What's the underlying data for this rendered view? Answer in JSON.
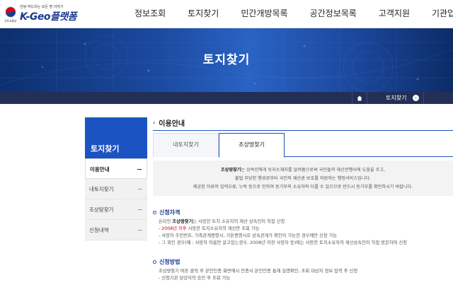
{
  "logo": {
    "slogan": "안녕 여드리는 모든 땅 이야기",
    "brand": "K-Geo플랫폼",
    "emblem_caption": "국토교통부"
  },
  "gnb": [
    "정보조회",
    "토지찾기",
    "민간개방목록",
    "공간정보목록",
    "고객지원",
    "기관업무"
  ],
  "hero": {
    "title": "토지찾기"
  },
  "breadcrumb": {
    "current": "토지찾기"
  },
  "sidebar": {
    "title": "토지찾기",
    "items": [
      {
        "label": "이용안내",
        "active": true
      },
      {
        "label": "내토지찾기",
        "active": false
      },
      {
        "label": "조상땅찾기",
        "active": false
      },
      {
        "label": "신청내역",
        "active": false
      }
    ]
  },
  "content": {
    "title": "이용안내",
    "tabs": [
      {
        "label": "내토지찾기",
        "active": false
      },
      {
        "label": "조상땅찾기",
        "active": true
      }
    ],
    "info": {
      "line1_bold": "조상땅찾기",
      "line1_rest": "는 상속인에게 토지소재지를 알려줌으로써 국민들의 재산관행사에 도움을 주고,",
      "line2": "불법 부당한 행위로부터 국민의 재산권 보호를 지원하는 행정서비스입니다.",
      "line3": "제공된 자료의 입력오류, 누락 등으로 인하여 등기부의 소유자와 다를 수 있으므로 반드시 등기부를 확인하시기 바랍니다."
    },
    "qualification": {
      "title": "신청자격",
      "line1_pre": "온라인 ",
      "line1_bold": "조상땅찾기",
      "line1_rest": "는 사망한 토지 소유자의 재산 상속인이 직접 신청",
      "line2_red": "- 2008년 이후",
      "line2_rest": " 사망한 토지소유자의 재산만 조회 가능",
      "line3": "- 사망자 주민번호, 가족관계증명서, 기본증명서로 상속관계가 확인이 가능한 경우에만 신청 가능",
      "line4": "- 그 외인 경우(예 : 사망자 이름만 알고있는경우, 2008년 이전 사망자 등)에는 사망한 토지소유자의 재산상속인이 직접 방문하여 신청"
    },
    "method": {
      "title": "신청방법",
      "line1": "조상땅찾기 버튼 클릭 후 본인인증 화면에서 인증서 본인인증 통해 실명확인, 조회 대상자 정보 입력 후 신청",
      "line2": "- 신청기관 담당자의 승인 후 조회 가능"
    }
  },
  "colors": {
    "primary": "#1b53c2",
    "crumbbar": "#232f57",
    "highlight": "#d0021b"
  }
}
